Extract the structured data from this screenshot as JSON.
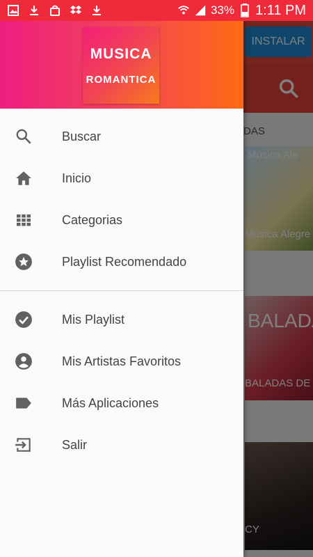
{
  "status_bar": {
    "battery": "33%",
    "time": "1:11 PM",
    "left_icons": [
      "gallery-icon",
      "download-icon",
      "bag-icon",
      "dropbox-icon",
      "download-icon"
    ],
    "right_icons": [
      "wifi-icon",
      "signal-icon",
      "battery-icon"
    ]
  },
  "header": {
    "logo_line1": "MUSICA",
    "logo_line2": "ROMANTICA"
  },
  "menu": [
    {
      "label": "Buscar",
      "icon": "search-icon"
    },
    {
      "label": "Inicio",
      "icon": "home-icon"
    },
    {
      "label": "Categorias",
      "icon": "grid-icon"
    },
    {
      "label": "Playlist Recomendado",
      "icon": "star-icon"
    },
    {
      "label": "Mis Playlist",
      "icon": "check-circle-icon"
    },
    {
      "label": "Mis Artistas Favoritos",
      "icon": "account-circle-icon"
    },
    {
      "label": "Más Aplicaciones",
      "icon": "label-icon"
    },
    {
      "label": "Salir",
      "icon": "exit-icon"
    }
  ],
  "background": {
    "install_label": "INSTALAR",
    "section_label": "DAS",
    "card1_title": "Música Ale",
    "card1_caption": "Música Alegre",
    "card2_title": "BALADA",
    "card2_caption": "BALADAS DE C",
    "card3_caption": "CY"
  },
  "colors": {
    "status_bar": "#ef2a3b",
    "header_start": "#ee1e7f",
    "header_end": "#ff6a13",
    "icon": "#616161",
    "text": "#444444"
  }
}
